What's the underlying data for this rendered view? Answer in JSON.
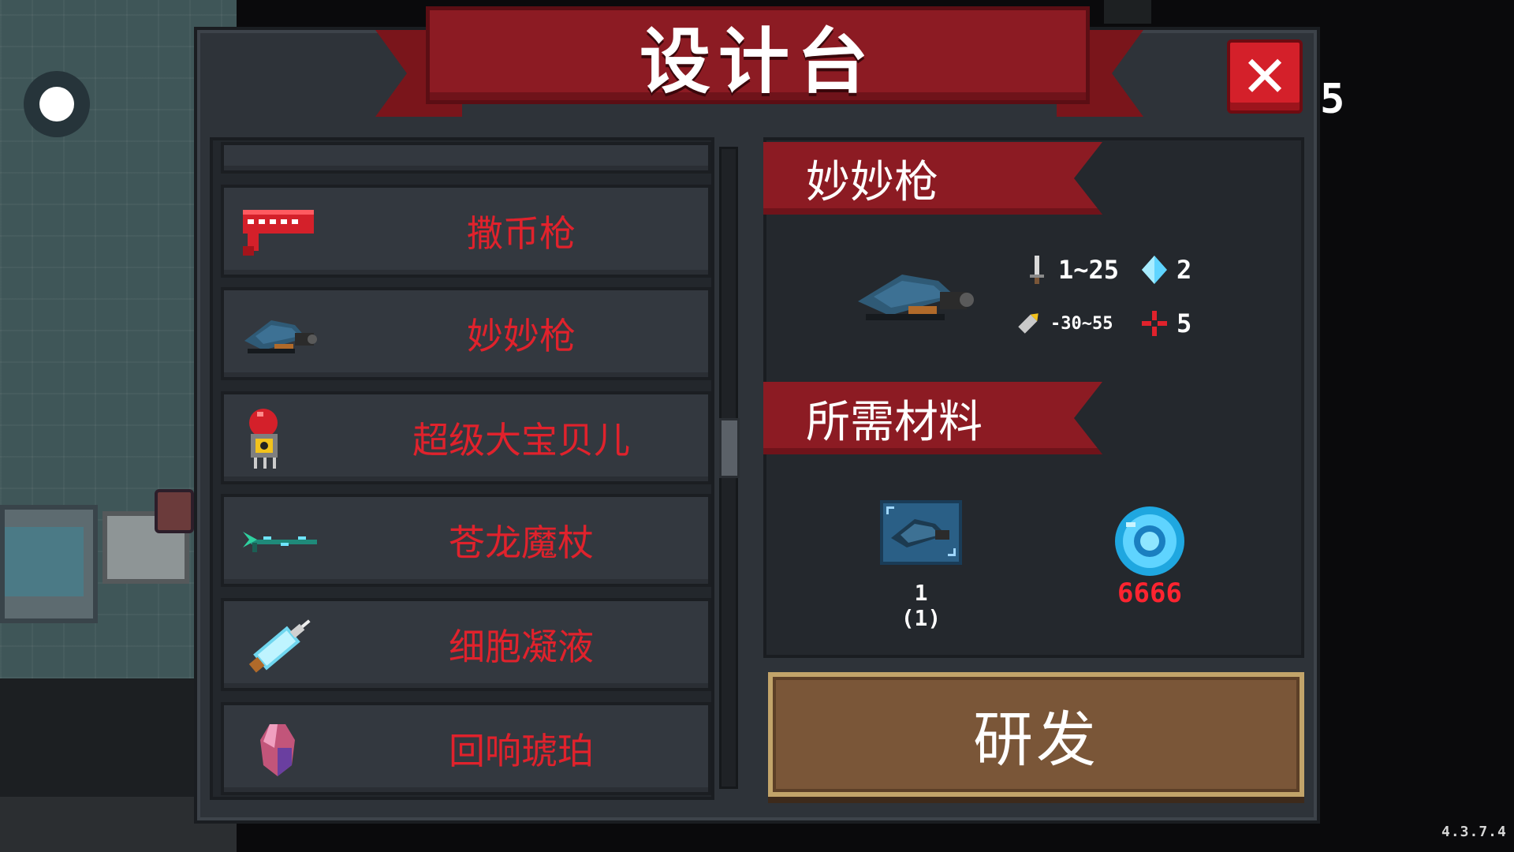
{
  "title": "设计台",
  "list": {
    "items": [
      {
        "label": "撒币枪"
      },
      {
        "label": "妙妙枪"
      },
      {
        "label": "超级大宝贝儿"
      },
      {
        "label": "苍龙魔杖"
      },
      {
        "label": "细胞凝液"
      },
      {
        "label": "回响琥珀"
      }
    ]
  },
  "detail": {
    "name": "妙妙枪",
    "stats": {
      "damage": "1~25",
      "energy": "2",
      "accuracy": "-30~55",
      "crit": "5"
    },
    "materials_header": "所需材料",
    "materials": [
      {
        "icon": "blueprint-icon",
        "count_top": "1",
        "count_bottom": "(1)"
      },
      {
        "icon": "gem-icon",
        "count": "6666"
      }
    ]
  },
  "research_label": "研发",
  "hud": {
    "edge_digit": "5",
    "version": "4.3.7.4"
  },
  "colors": {
    "banner_red": "#8c1b23",
    "item_name_red": "#e0222c",
    "gem_count_red": "#ff2430",
    "button_brown": "#7a5638"
  }
}
